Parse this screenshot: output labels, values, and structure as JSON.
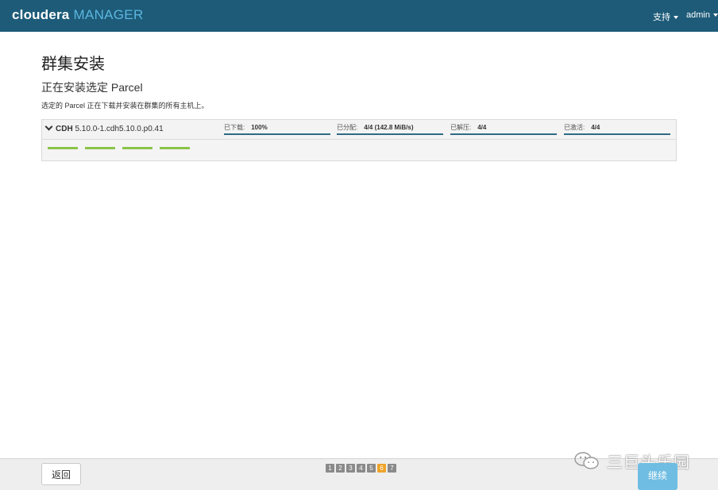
{
  "header": {
    "brand_primary": "cloudera",
    "brand_secondary": "MANAGER",
    "support_menu": "支持",
    "user_menu": "admin",
    "bar_color": "#1d5b79"
  },
  "page": {
    "title": "群集安装",
    "subtitle": "正在安装选定 Parcel",
    "description": "选定的 Parcel 正在下载并安装在群集的所有主机上。"
  },
  "parcel": {
    "name": "CDH",
    "version": "5.10.0-1.cdh5.10.0.p0.41",
    "stages": [
      {
        "label": "已下载:",
        "value": "100%"
      },
      {
        "label": "已分配:",
        "value": "4/4 (142.8 MiB/s)"
      },
      {
        "label": "已解压:",
        "value": "4/4"
      },
      {
        "label": "已激活:",
        "value": "4/4"
      }
    ],
    "host_count": 4,
    "host_bar_color": "#8cc34a"
  },
  "footer": {
    "back_label": "返回",
    "continue_label": "继续",
    "steps": [
      "1",
      "2",
      "3",
      "4",
      "5",
      "6",
      "7"
    ],
    "active_step": "6",
    "watermark_text": "三巨头乐园"
  }
}
